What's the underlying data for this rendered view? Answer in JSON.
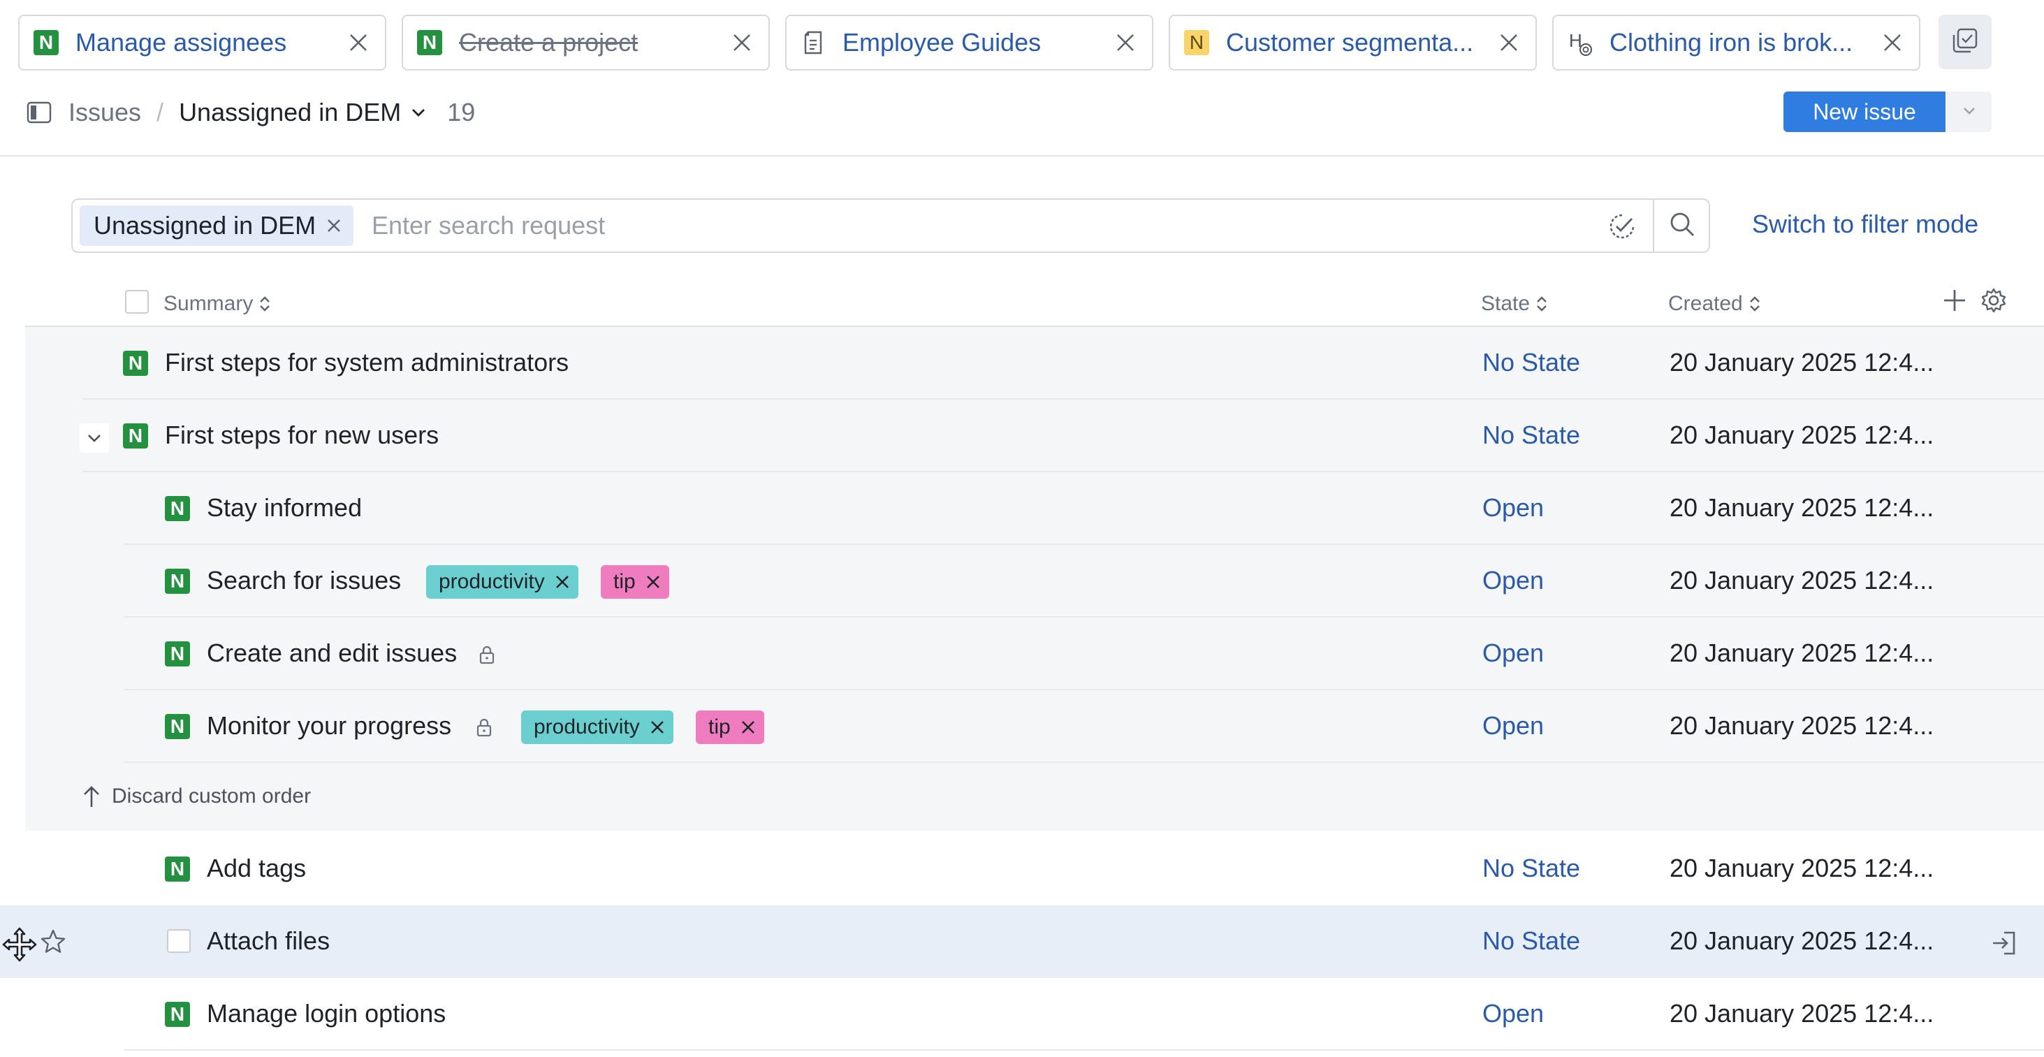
{
  "tabs": [
    {
      "label": "Manage assignees",
      "icon": "n-badge-icon",
      "badge": "N",
      "strikethrough": false
    },
    {
      "label": "Create a project",
      "icon": "n-badge-icon",
      "badge": "N",
      "strikethrough": true
    },
    {
      "label": "Employee Guides",
      "icon": "document-icon",
      "badge": "",
      "strikethrough": false
    },
    {
      "label": "Customer segmenta...",
      "icon": "n-badge-icon",
      "badge": "N",
      "strikethrough": false
    },
    {
      "label": "Clothing iron is brok...",
      "icon": "helpdesk-icon",
      "badge": "H",
      "strikethrough": false
    }
  ],
  "breadcrumb": {
    "root": "Issues",
    "separator": "/",
    "current": "Unassigned in DEM",
    "count": "19"
  },
  "toolbar": {
    "new_issue_label": "New issue"
  },
  "search": {
    "chip_label": "Unassigned in DEM",
    "placeholder": "Enter search request",
    "value": "",
    "filter_mode_label": "Switch to filter mode"
  },
  "table": {
    "columns": {
      "summary": "Summary",
      "state": "State",
      "created": "Created"
    },
    "discard_label": "Discard custom order",
    "rows": [
      {
        "badge": "N",
        "title": "First steps for system administrators",
        "state": "No State",
        "created": "20 January 2025 12:4...",
        "tags": [],
        "locked": false
      },
      {
        "badge": "N",
        "title": "First steps for new users",
        "state": "No State",
        "created": "20 January 2025 12:4...",
        "tags": [],
        "locked": false,
        "expanded": true
      },
      {
        "badge": "N",
        "title": "Stay informed",
        "state": "Open",
        "created": "20 January 2025 12:4...",
        "tags": [],
        "locked": false
      },
      {
        "badge": "N",
        "title": "Search for issues",
        "state": "Open",
        "created": "20 January 2025 12:4...",
        "tags": [
          "productivity",
          "tip"
        ],
        "locked": false
      },
      {
        "badge": "N",
        "title": "Create and edit issues",
        "state": "Open",
        "created": "20 January 2025 12:4...",
        "tags": [],
        "locked": true
      },
      {
        "badge": "N",
        "title": "Monitor your progress",
        "state": "Open",
        "created": "20 January 2025 12:4...",
        "tags": [
          "productivity",
          "tip"
        ],
        "locked": true
      },
      {
        "badge": "N",
        "title": "Add tags",
        "state": "No State",
        "created": "20 January 2025 12:4...",
        "tags": [],
        "locked": false
      },
      {
        "badge": "",
        "title": "Attach files",
        "state": "No State",
        "created": "20 January 2025 12:4...",
        "tags": [],
        "locked": false,
        "hovered": true
      },
      {
        "badge": "N",
        "title": "Manage login options",
        "state": "Open",
        "created": "20 January 2025 12:4...",
        "tags": [],
        "locked": false
      }
    ]
  },
  "colors": {
    "accent": "#2f7de1",
    "link": "#2a5aa8",
    "badge_green": "#23913f",
    "badge_yellow": "#f8d46a",
    "tag_productivity": "#6ccfcf",
    "tag_tip": "#f07cc0",
    "hover_row": "#e8eef8"
  }
}
